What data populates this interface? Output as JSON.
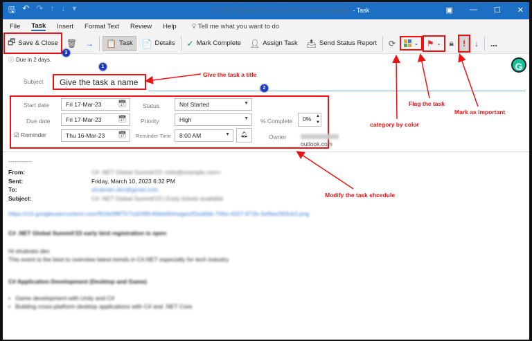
{
  "window": {
    "title_suffix": "- Task",
    "title_blurred": "C# .NET Global Summit'23 | Early tickets available"
  },
  "menu": {
    "items": [
      "File",
      "Task",
      "Insert",
      "Format Text",
      "Review",
      "Help"
    ],
    "active": "Task",
    "tell_me": "Tell me what you want to do"
  },
  "ribbon": {
    "save_close": "Save & Close",
    "task": "Task",
    "details": "Details",
    "mark_complete": "Mark Complete",
    "assign_task": "Assign Task",
    "send_status": "Send Status Report",
    "more": "..."
  },
  "info": {
    "due": "Due in 2 days."
  },
  "form": {
    "subject_label": "Subject",
    "subject_value": "Give the task a name",
    "start_label": "Start date",
    "start_value": "Fri 17-Mar-23",
    "due_label": "Due date",
    "due_value": "Fri 17-Mar-23",
    "reminder_label": "Reminder",
    "reminder_value": "Thu 16-Mar-23",
    "reminder_checked": true,
    "status_label": "Status",
    "status_value": "Not Started",
    "priority_label": "Priority",
    "priority_value": "High",
    "reminder_time_label": "Reminder Time",
    "reminder_time_value": "8:00 AM",
    "complete_label": "% Complete",
    "complete_value": "0%",
    "owner_label": "Owner",
    "owner_value": "outlook.com"
  },
  "annotations": {
    "title": "Give the task a title",
    "schedule": "Modify the task shcedule",
    "category": "category by color",
    "flag": "Flag the task",
    "important": "Mark as important",
    "badges": [
      "1",
      "2",
      "3"
    ]
  },
  "email": {
    "dashes": "------------",
    "from_label": "From:",
    "from_value": "C# .NET Global Summit'23 <info@example.com>",
    "sent_label": "Sent:",
    "sent_value": "Friday, March 10, 2023 6:32 PM",
    "to_label": "To:",
    "to_value": "shubrato.dev@gmail.com",
    "subject_label": "Subject:",
    "subject_value": "C# .NET Global Summit'23 | Early tickets available",
    "link": "https://ci3.googleusercontent.com/f61fe0f8f7571d249fc4fdeb9/images/f2ea6bb-706a-4327-972b-3ef6ee393cb3.png",
    "paragraphs": [
      "C# .NET Global Summit'23 early bird registration is open",
      "Hi shubrato dev",
      "This event is the best to overview latest trends in C#.NET especially for tech industry",
      "C# Application Development (Desktop and Game)",
      "Game development with Unity and C#",
      "Building cross-platform desktop applications with C# and .NET Core"
    ]
  },
  "colors": {
    "accent": "#1d6fc4",
    "annotation": "#e11111",
    "badge": "#1838d6"
  }
}
